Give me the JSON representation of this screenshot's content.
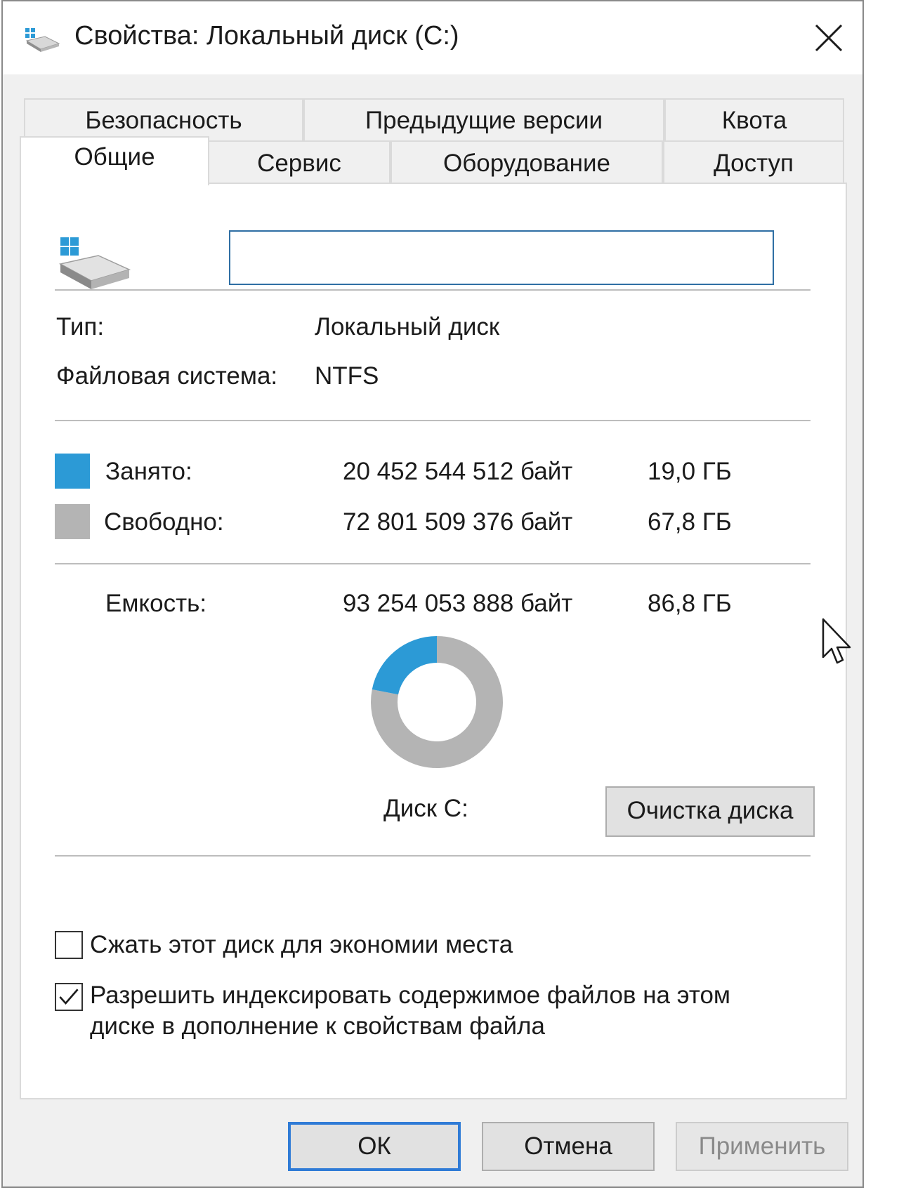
{
  "window": {
    "title": "Свойства: Локальный диск (C:)"
  },
  "tabs": {
    "row1": [
      "Безопасность",
      "Предыдущие версии",
      "Квота"
    ],
    "row2": [
      "Общие",
      "Сервис",
      "Оборудование",
      "Доступ"
    ],
    "active": "Общие"
  },
  "general": {
    "name_value": "",
    "type_label": "Тип:",
    "type_value": "Локальный диск",
    "fs_label": "Файловая система:",
    "fs_value": "NTFS",
    "used_label": "Занято:",
    "used_bytes": "20 452 544 512 байт",
    "used_gb": "19,0 ГБ",
    "free_label": "Свободно:",
    "free_bytes": "72 801 509 376 байт",
    "free_gb": "67,8 ГБ",
    "capacity_label": "Емкость:",
    "capacity_bytes": "93 254 053 888 байт",
    "capacity_gb": "86,8 ГБ",
    "used_fraction": 0.2193,
    "disk_label": "Диск С:",
    "cleanup_button": "Очистка диска",
    "compress_label": "Сжать этот диск для экономии места",
    "compress_checked": false,
    "index_label_line1": "Разрешить индексировать содержимое файлов на этом",
    "index_label_line2": "диске в дополнение к свойствам файла",
    "index_checked": true
  },
  "colors": {
    "used": "#2c9ad6",
    "free": "#b4b4b4"
  },
  "buttons": {
    "ok": "ОК",
    "cancel": "Отмена",
    "apply": "Применить"
  }
}
